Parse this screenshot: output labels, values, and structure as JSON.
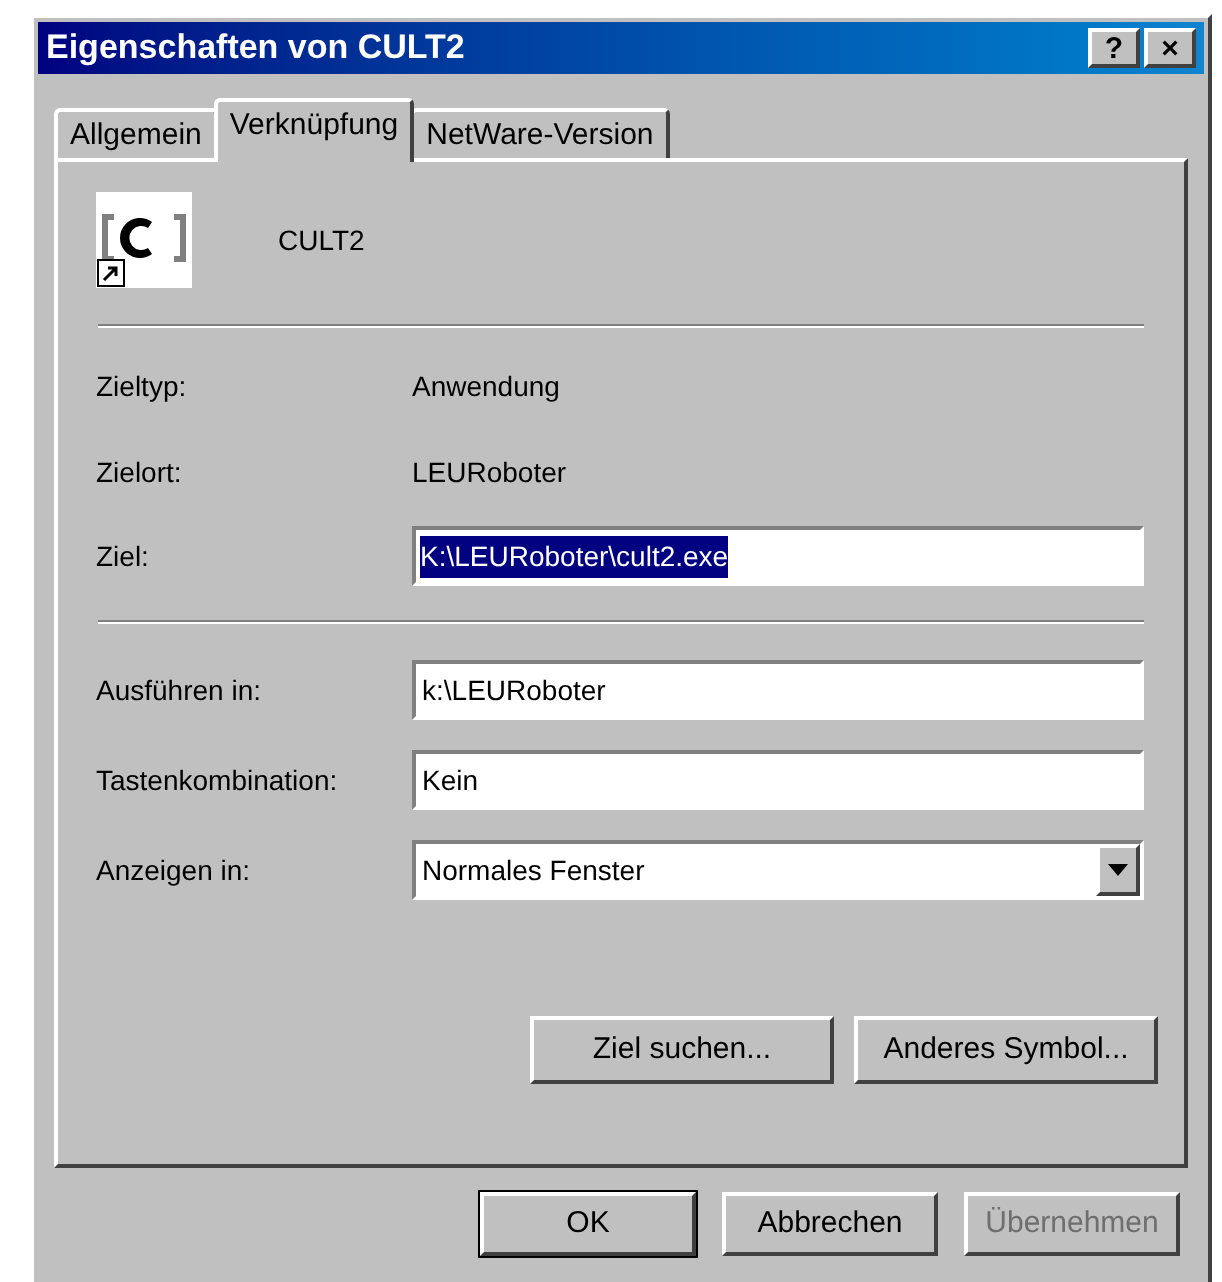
{
  "window": {
    "title": "Eigenschaften von CULT2",
    "title_buttons": [
      "?",
      "×"
    ]
  },
  "tabs": [
    {
      "label": "Allgemein",
      "selected": false
    },
    {
      "label": "Verknüpfung",
      "selected": true
    },
    {
      "label": "NetWare-Version",
      "selected": false
    }
  ],
  "shortcut": {
    "name": "CULT2"
  },
  "info": [
    {
      "label": "Zieltyp:",
      "value": "Anwendung"
    },
    {
      "label": "Zielort:",
      "value": "LEURoboter"
    }
  ],
  "target": {
    "label": "Ziel:",
    "value": "K:\\LEURoboter\\cult2.exe",
    "text_selected": true
  },
  "fields": [
    {
      "kind": "text",
      "label": "Ausführen in:",
      "value": "k:\\LEURoboter"
    },
    {
      "kind": "text",
      "label": "Tastenkombination:",
      "value": "Kein"
    },
    {
      "kind": "dropdown",
      "label": "Anzeigen in:",
      "value": "Normales Fenster"
    }
  ],
  "panel_buttons": [
    "Ziel suchen...",
    "Anderes Symbol..."
  ],
  "buttons": [
    {
      "label": "OK",
      "default": true,
      "disabled": false
    },
    {
      "label": "Abbrechen",
      "default": false,
      "disabled": false
    },
    {
      "label": "Übernehmen",
      "default": false,
      "disabled": true
    }
  ]
}
